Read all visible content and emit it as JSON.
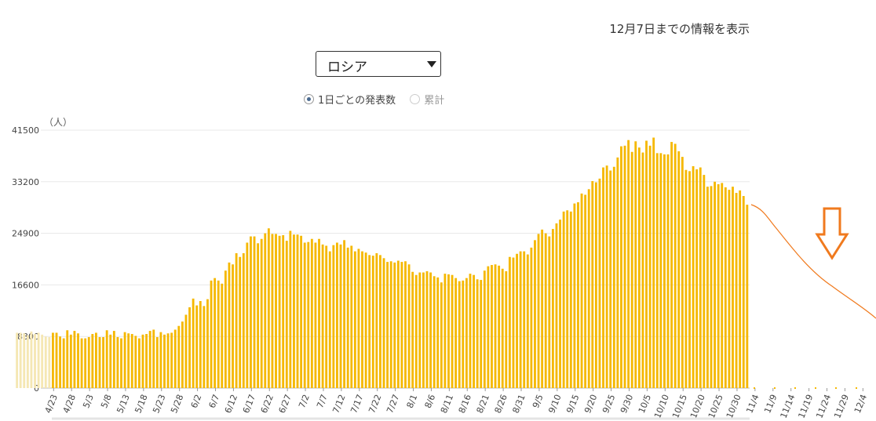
{
  "header": {
    "info_text": "12月7日までの情報を表示",
    "country_select": "ロシア",
    "radio_daily": "1日ごとの発表数",
    "radio_cumulative": "累計"
  },
  "chart_data": {
    "type": "bar",
    "unit_label": "（人）",
    "ylim": [
      0,
      41500
    ],
    "yticks": [
      0,
      8300,
      16600,
      24900,
      33200,
      41500
    ],
    "grid": true,
    "color": "#f5b800",
    "x_tick_labels": [
      "4/23",
      "4/28",
      "5/3",
      "5/8",
      "5/13",
      "5/18",
      "5/23",
      "5/28",
      "6/2",
      "6/7",
      "6/12",
      "6/17",
      "6/22",
      "6/27",
      "7/2",
      "7/7",
      "7/12",
      "7/17",
      "7/22",
      "7/27",
      "8/1",
      "8/6",
      "8/11",
      "8/16",
      "8/21",
      "8/26",
      "8/31",
      "9/5",
      "9/10",
      "9/15",
      "9/20",
      "9/25",
      "9/30",
      "10/5",
      "10/10",
      "10/15",
      "10/20",
      "10/25",
      "10/30",
      "11/4",
      "11/9",
      "11/14",
      "11/19",
      "11/24",
      "11/29",
      "12/4"
    ],
    "dates_start": "4/23",
    "dates_end": "12/7",
    "values": [
      8900,
      8900,
      8300,
      8000,
      9300,
      8600,
      9200,
      8800,
      8000,
      8000,
      8200,
      8700,
      8900,
      8200,
      8200,
      9300,
      8600,
      9200,
      8200,
      8000,
      9000,
      8800,
      8700,
      8400,
      8000,
      8600,
      8700,
      9200,
      9400,
      8200,
      9000,
      8600,
      8800,
      8900,
      9400,
      10000,
      10700,
      11800,
      13000,
      14400,
      13300,
      14000,
      13200,
      14300,
      17300,
      17700,
      17300,
      16800,
      18900,
      20200,
      19900,
      21700,
      21100,
      21700,
      23400,
      24400,
      24400,
      23300,
      24000,
      24900,
      25700,
      24800,
      24800,
      24500,
      24600,
      23700,
      25300,
      24700,
      24700,
      24500,
      23400,
      23500,
      24000,
      23400,
      24000,
      23100,
      22900,
      22000,
      23000,
      23400,
      23100,
      23800,
      22600,
      22900,
      22000,
      22400,
      22000,
      21800,
      21400,
      21300,
      21700,
      21400,
      20900,
      20300,
      20400,
      20200,
      20500,
      20300,
      20400,
      19900,
      18700,
      18200,
      18600,
      18600,
      18800,
      18600,
      18000,
      17800,
      17000,
      18400,
      18300,
      18200,
      17700,
      17200,
      17300,
      17700,
      18400,
      18200,
      17500,
      17400,
      18900,
      19600,
      19800,
      19900,
      19700,
      19200,
      18800,
      21100,
      21000,
      21600,
      22000,
      22000,
      21500,
      22600,
      23800,
      24800,
      25500,
      24900,
      24400,
      25600,
      26500,
      27100,
      28400,
      28600,
      28400,
      29700,
      29900,
      31300,
      31100,
      32000,
      33300,
      33100,
      33700,
      35500,
      35800,
      35000,
      35600,
      37100,
      38900,
      39000,
      39900,
      38000,
      39700,
      38700,
      37900,
      39800,
      39000,
      40300,
      37800,
      37800,
      37600,
      37600,
      39600,
      39300,
      38100,
      37200,
      35100,
      34900,
      35700,
      35200,
      35500,
      34300,
      32400,
      32500,
      33200,
      32800,
      33000,
      32300,
      31900,
      32400,
      31400,
      31800,
      30900,
      29500
    ],
    "pre_period_values": [
      8900,
      8900,
      8800,
      8500,
      9100,
      8700,
      8900,
      8600,
      8300,
      8200
    ]
  }
}
